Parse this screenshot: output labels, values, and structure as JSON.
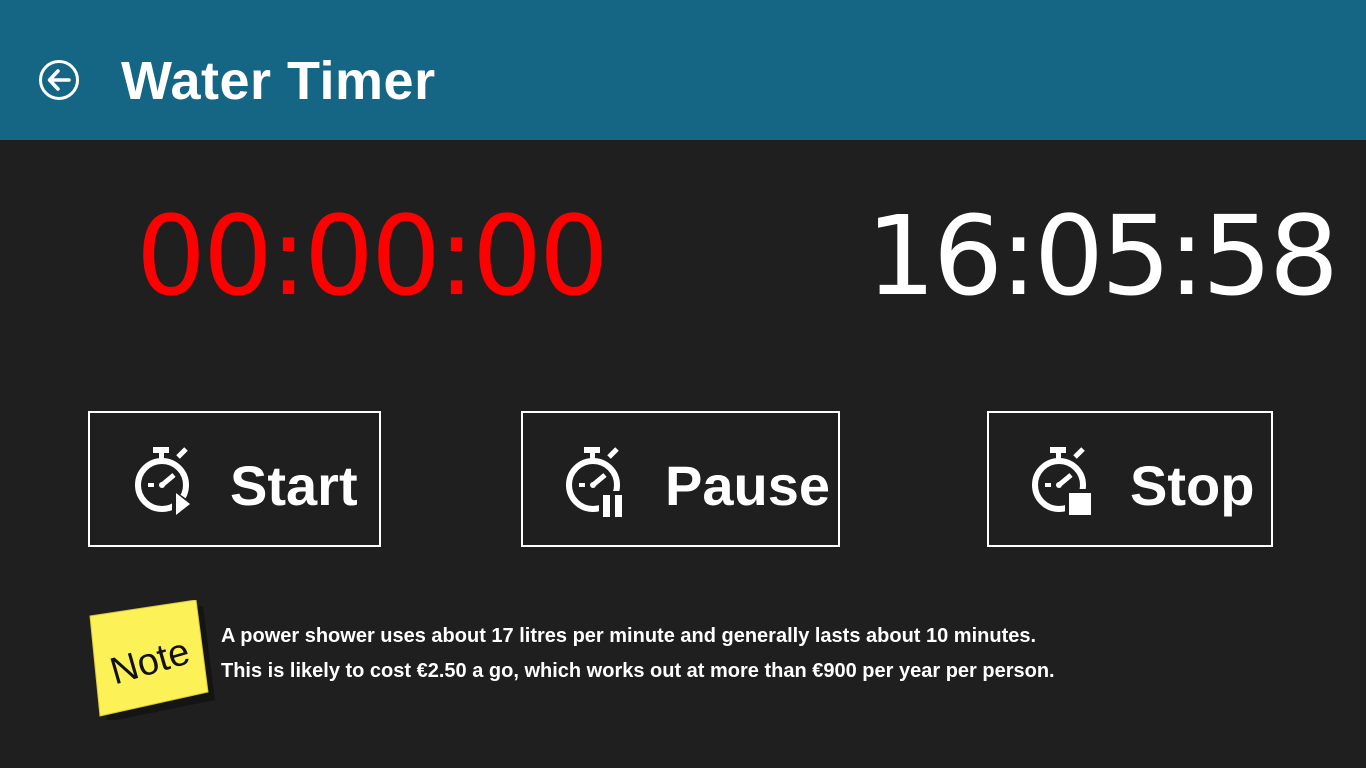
{
  "header": {
    "title": "Water Timer",
    "back_icon": "back-arrow-circle-icon",
    "background_color": "#156684"
  },
  "timers": {
    "elapsed": "00:00:00",
    "elapsed_color": "#ff0000",
    "clock": "16:05:58",
    "clock_color": "#ffffff"
  },
  "controls": {
    "start": {
      "label": "Start",
      "icon": "stopwatch-play-icon"
    },
    "pause": {
      "label": "Pause",
      "icon": "stopwatch-pause-icon"
    },
    "stop": {
      "label": "Stop",
      "icon": "stopwatch-stop-icon"
    }
  },
  "note": {
    "sticker_label": "Note",
    "sticker_color": "#fdf158",
    "lines": [
      "A power shower uses about 17 litres per minute and generally lasts about 10 minutes.",
      "This is likely to cost €2.50 a go, which works out at more than €900 per year per person."
    ]
  }
}
